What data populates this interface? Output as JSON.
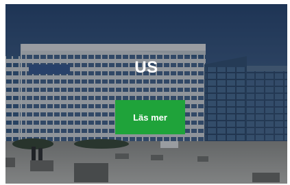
{
  "hero": {
    "title": "US",
    "cta_label": "Läs mer",
    "background_image": "building-exterior-photo"
  },
  "colors": {
    "cta_background": "#1fa33a",
    "overlay": "rgba(10,18,30,0.38)",
    "text": "#ffffff"
  }
}
